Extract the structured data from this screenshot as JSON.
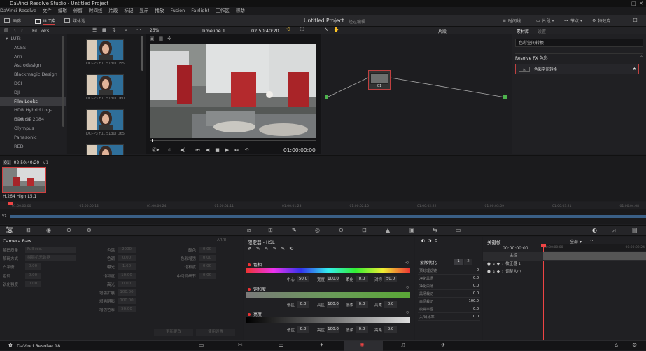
{
  "app": {
    "title": "DaVinci Resolve Studio - Untitled Project"
  },
  "menu": [
    "DaVinci Resolve",
    "文件",
    "编辑",
    "修剪",
    "时间线",
    "片段",
    "标记",
    "显示",
    "播放",
    "Fusion",
    "Fairlight",
    "工作区",
    "帮助"
  ],
  "toolbar": {
    "gallery": "画廊",
    "lut_lib": "LUT库",
    "media_pool": "媒体池",
    "project_name": "Untitled Project",
    "edited": "经过编辑",
    "timeline_btn": "时间线",
    "clips_btn": "片段",
    "nodes_btn": "节点",
    "effects_btn": "特效库"
  },
  "subtoolbar": {
    "folder": "Fil...oks",
    "zoom": "25%",
    "timeline_name": "Timeline 1",
    "timecode": "02:50:40:20",
    "clip_label": "片段",
    "tab_material": "素材库",
    "tab_settings": "设置"
  },
  "lut_tree": {
    "root": "LUTs",
    "items": [
      "ACES",
      "Arri",
      "Astrodesign",
      "Blackmagic Design",
      "DCI",
      "DJI",
      "Film Looks",
      "HDR Hybrid Log-Gamma",
      "HDR ST 2084",
      "Olympus",
      "Panasonic",
      "RED"
    ],
    "selected": "Film Looks"
  },
  "lut_thumbs": [
    "DCI-P3 Fu...5130I D55",
    "DCI-P3 Fu...5130I D60",
    "DCI-P3 Fu...5130I D65",
    "DCI-P3 Fu...5130I D65"
  ],
  "viewer": {
    "timecode": "01:00:00:00"
  },
  "nodes": {
    "node_label": "01"
  },
  "effects": {
    "search": "色彩空间转换",
    "section": "Resolve FX 色彩",
    "item": "色彩空间转换"
  },
  "clip_strip": {
    "index": "01",
    "timecode": "02:50:40:20",
    "track": "V1",
    "codec": "H.264 High L5.1"
  },
  "mini_timeline": {
    "track": "V1",
    "ticks": [
      "01:00:00:00",
      "01:00:00:12",
      "01:00:00:24",
      "01:00:01:11",
      "01:00:01:23",
      "01:00:02:10",
      "01:00:02:22",
      "01:00:03:09",
      "01:00:03:21",
      "01:00:04:08"
    ]
  },
  "camera_raw": {
    "title": "Camera Raw",
    "mode_tag": "ARRI",
    "rows": [
      {
        "label": "解码质量",
        "value": "Full res."
      },
      {
        "label": "解码方式",
        "value": "摄影机元数据"
      },
      {
        "label": "白平衡",
        "value": "0.00"
      },
      {
        "label": "色调",
        "value": "0.00"
      },
      {
        "label": "锐化强度",
        "value": "0.00"
      }
    ],
    "mid": [
      {
        "label": "色温",
        "value": "2000"
      },
      {
        "label": "色调",
        "value": "0.00"
      },
      {
        "label": "曝光",
        "value": "1.60"
      },
      {
        "label": "饱和度",
        "value": "10.00"
      },
      {
        "label": "高光",
        "value": "0.00"
      },
      {
        "label": "增强扩展",
        "value": "100.00"
      },
      {
        "label": "增强阴影",
        "value": "100.00"
      },
      {
        "label": "增强色彩",
        "value": "50.00"
      }
    ],
    "right": [
      {
        "label": "颜色",
        "value": "0.00"
      },
      {
        "label": "色彩增强",
        "value": "0.00"
      },
      {
        "label": "饱和度",
        "value": "0.00"
      },
      {
        "label": "中间调细节",
        "value": "0.00"
      }
    ],
    "btn_update": "更新更改",
    "btn_use": "使用设置"
  },
  "qualifier": {
    "title": "限定器 - HSL",
    "hue": {
      "label": "色相",
      "center_l": "中心",
      "center": "50.0",
      "width_l": "宽度",
      "width": "100.0",
      "soft_l": "柔化",
      "soft": "0.0",
      "sym_l": "对称",
      "sym": "50.0"
    },
    "sat": {
      "label": "饱和度",
      "low_l": "低区",
      "low": "0.0",
      "high_l": "高区",
      "high": "100.0",
      "lsoft_l": "低柔",
      "lsoft": "0.0",
      "hsoft_l": "高柔",
      "hsoft": "0.0"
    },
    "lum": {
      "label": "亮度",
      "low_l": "低区",
      "low": "0.0",
      "high_l": "高区",
      "high": "100.0",
      "lsoft_l": "低柔",
      "lsoft": "0.0",
      "hsoft_l": "高柔",
      "hsoft": "0.0"
    }
  },
  "matte": {
    "title": "蒙版优化",
    "tab1": "1",
    "tab2": "2",
    "rows": [
      {
        "label": "预处理滤镜",
        "value": "0"
      },
      {
        "label": "净化黑场",
        "value": "0.0"
      },
      {
        "label": "净化白场",
        "value": "0.0"
      },
      {
        "label": "黑场裁切",
        "value": "0.0"
      },
      {
        "label": "白场裁切",
        "value": "100.0"
      },
      {
        "label": "模糊半径",
        "value": "0.0"
      },
      {
        "label": "入/出比率",
        "value": "0.0"
      }
    ]
  },
  "keyframes": {
    "title": "关键帧",
    "filter": "全部",
    "tc_start": "00:00:00:00",
    "tc_end": "00:00:02:24",
    "tc_mid": "00:00:00:00",
    "rows": [
      "主控",
      "校正器 1",
      "调整大小"
    ]
  },
  "pagebar": {
    "brand": "DaVinci Resolve 18"
  }
}
